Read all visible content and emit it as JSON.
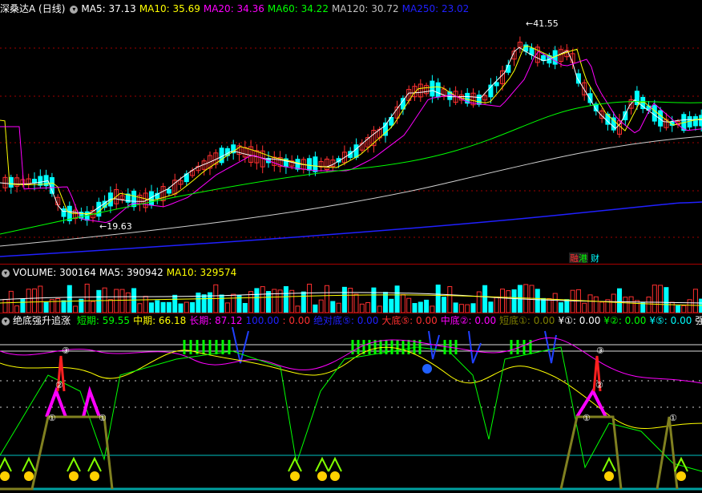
{
  "main": {
    "title": "深桑达A (日线)",
    "ma": [
      {
        "label": "MA5: 37.13",
        "color": "#ffffff"
      },
      {
        "label": "MA10: 35.69",
        "color": "#ffff00"
      },
      {
        "label": "MA20: 34.36",
        "color": "#ff00ff"
      },
      {
        "label": "MA60: 34.22",
        "color": "#00ff00"
      },
      {
        "label": "MA120: 30.72",
        "color": "#c0c0c0"
      },
      {
        "label": "MA250: 23.02",
        "color": "#2020ff"
      }
    ],
    "high_label": "41.55",
    "low_label": "19.63",
    "badge1": "融",
    "badge1b": "港",
    "badge2": "财"
  },
  "volume": {
    "items": [
      {
        "label": "VOLUME: 300164",
        "color": "#ffffff"
      },
      {
        "label": "MA5: 390942",
        "color": "#ffffff"
      },
      {
        "label": "MA10: 329574",
        "color": "#ffff00"
      }
    ]
  },
  "indicator": {
    "name": "绝底强升追涨",
    "items": [
      {
        "label": "短期: 59.55",
        "color": "#00ff00"
      },
      {
        "label": "中期: 66.18",
        "color": "#ffff00"
      },
      {
        "label": "长期: 87.12",
        "color": "#ff00ff"
      },
      {
        "label": "100.00",
        "color": "#2020ff"
      },
      {
        "label": ": 0.00",
        "color": "#ff3030"
      },
      {
        "label": "绝对底⑤: 0.00",
        "color": "#2020ff"
      },
      {
        "label": "大底⑤: 0.00",
        "color": "#ff3030"
      },
      {
        "label": "中底②: 0.00",
        "color": "#ff00ff"
      },
      {
        "label": "短底①: 0.00",
        "color": "#808000"
      },
      {
        "label": "¥①: 0.00",
        "color": "#ffffff"
      },
      {
        "label": "¥②: 0.00",
        "color": "#00ff00"
      },
      {
        "label": "¥⑤: 0.00",
        "color": "#00ffff"
      },
      {
        "label": "强弱",
        "color": "#ffffff"
      }
    ]
  },
  "colors": {
    "up": "#ff3030",
    "down": "#00ffff",
    "grid": "#a00000"
  }
}
